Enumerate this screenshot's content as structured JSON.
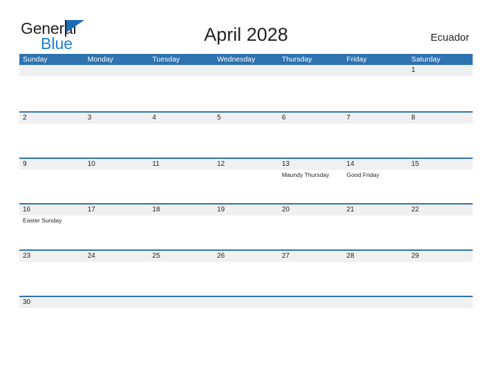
{
  "header": {
    "logo": {
      "word1": "General",
      "word2": "Blue",
      "flag_icon": "triangle-flag-icon",
      "brand_dark": "#231f20",
      "brand_blue": "#1c7fd1"
    },
    "title": "April 2028",
    "country": "Ecuador"
  },
  "calendar": {
    "accent_color": "#2e72b0",
    "band_color": "#f0f0f0",
    "weekdays": [
      "Sunday",
      "Monday",
      "Tuesday",
      "Wednesday",
      "Thursday",
      "Friday",
      "Saturday"
    ],
    "weeks": [
      [
        {
          "day": "",
          "event": ""
        },
        {
          "day": "",
          "event": ""
        },
        {
          "day": "",
          "event": ""
        },
        {
          "day": "",
          "event": ""
        },
        {
          "day": "",
          "event": ""
        },
        {
          "day": "",
          "event": ""
        },
        {
          "day": "1",
          "event": ""
        }
      ],
      [
        {
          "day": "2",
          "event": ""
        },
        {
          "day": "3",
          "event": ""
        },
        {
          "day": "4",
          "event": ""
        },
        {
          "day": "5",
          "event": ""
        },
        {
          "day": "6",
          "event": ""
        },
        {
          "day": "7",
          "event": ""
        },
        {
          "day": "8",
          "event": ""
        }
      ],
      [
        {
          "day": "9",
          "event": ""
        },
        {
          "day": "10",
          "event": ""
        },
        {
          "day": "11",
          "event": ""
        },
        {
          "day": "12",
          "event": ""
        },
        {
          "day": "13",
          "event": "Maundy Thursday"
        },
        {
          "day": "14",
          "event": "Good Friday"
        },
        {
          "day": "15",
          "event": ""
        }
      ],
      [
        {
          "day": "16",
          "event": "Easter Sunday"
        },
        {
          "day": "17",
          "event": ""
        },
        {
          "day": "18",
          "event": ""
        },
        {
          "day": "19",
          "event": ""
        },
        {
          "day": "20",
          "event": ""
        },
        {
          "day": "21",
          "event": ""
        },
        {
          "day": "22",
          "event": ""
        }
      ],
      [
        {
          "day": "23",
          "event": ""
        },
        {
          "day": "24",
          "event": ""
        },
        {
          "day": "25",
          "event": ""
        },
        {
          "day": "26",
          "event": ""
        },
        {
          "day": "27",
          "event": ""
        },
        {
          "day": "28",
          "event": ""
        },
        {
          "day": "29",
          "event": ""
        }
      ],
      [
        {
          "day": "30",
          "event": ""
        },
        {
          "day": "",
          "event": ""
        },
        {
          "day": "",
          "event": ""
        },
        {
          "day": "",
          "event": ""
        },
        {
          "day": "",
          "event": ""
        },
        {
          "day": "",
          "event": ""
        },
        {
          "day": "",
          "event": ""
        }
      ]
    ]
  }
}
